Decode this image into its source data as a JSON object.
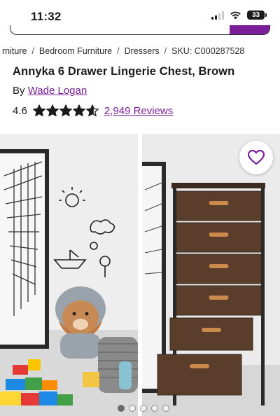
{
  "status_bar": {
    "time": "11:32",
    "battery": "33"
  },
  "breadcrumb": {
    "items": [
      "rniture",
      "Bedroom Furniture",
      "Dressers"
    ],
    "separator": "/",
    "sku": "SKU: C000287528"
  },
  "product": {
    "title": "Annyka 6 Drawer Lingerie Chest, Brown",
    "by_label": "By",
    "brand": "Wade Logan",
    "rating": "4.6",
    "stars": 4.6,
    "reviews": "2,949 Reviews"
  },
  "gallery": {
    "image_count": 5,
    "active_index": 0
  },
  "colors": {
    "brand_purple": "#7b1f99",
    "text": "#1a1a1a",
    "drawer_brown": "#5a3d2b",
    "handle": "#c98a4b"
  },
  "icons": {
    "favorite": "heart-outline-icon",
    "star": "star-icon"
  }
}
